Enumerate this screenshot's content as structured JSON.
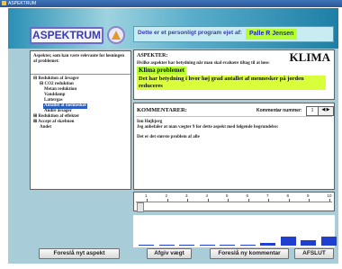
{
  "window": {
    "title": "ASPEKTRUM"
  },
  "header": {
    "logo": "ASPEKTRUM",
    "question": "Dette er et personligt program ejet af:",
    "owner": "Palle R Jensen"
  },
  "tree": {
    "header": "Aspekter, som kan være relevante for løsningen af problemet:",
    "items": [
      "Reduktion af årsager",
      "CO2 reduktion",
      "Metan reduktion",
      "Vanddamp",
      "Lattergas",
      "Antallet af mennesker",
      "Andre årsager",
      "Reduktion af effekter",
      "Accept af skæbnen",
      "Andet"
    ]
  },
  "aspekter": {
    "label": "ASPEKTER:",
    "big": "KLIMA",
    "question": "Hvilke aspekter har betydning når man skal evaluere tiltag til at løse:",
    "problem": "Klima problemet",
    "statement": "Det har betydning i hvor høj grad antallet af mennesker på jorden reduceres"
  },
  "kommentarer": {
    "label": "KOMMENTARER:",
    "nummer_label": "Kommentar nummer:",
    "nummer": "1",
    "author": "Inn Højbjerg",
    "text1": "Jeg anbefaler at man vægter 9 for dette aspekt med følgende begrundelse:",
    "text2": "Det er det største problem af alle"
  },
  "scale": {
    "numbers": [
      "1",
      "2",
      "3",
      "4",
      "5",
      "6",
      "7",
      "8",
      "9",
      "10"
    ]
  },
  "chart_data": {
    "type": "bar",
    "categories": [
      "1",
      "2",
      "3",
      "4",
      "5",
      "6",
      "7",
      "8",
      "9",
      "10"
    ],
    "values": [
      0,
      0,
      0,
      0,
      0,
      0,
      1,
      3,
      2,
      3
    ],
    "color": "#1f3fd0"
  },
  "buttons": {
    "new_aspect": "Foreslå nyt aspekt",
    "give_weight": "Afgiv vægt",
    "new_comment": "Foreslå ny kommentar",
    "exit": "AFSLUT"
  }
}
